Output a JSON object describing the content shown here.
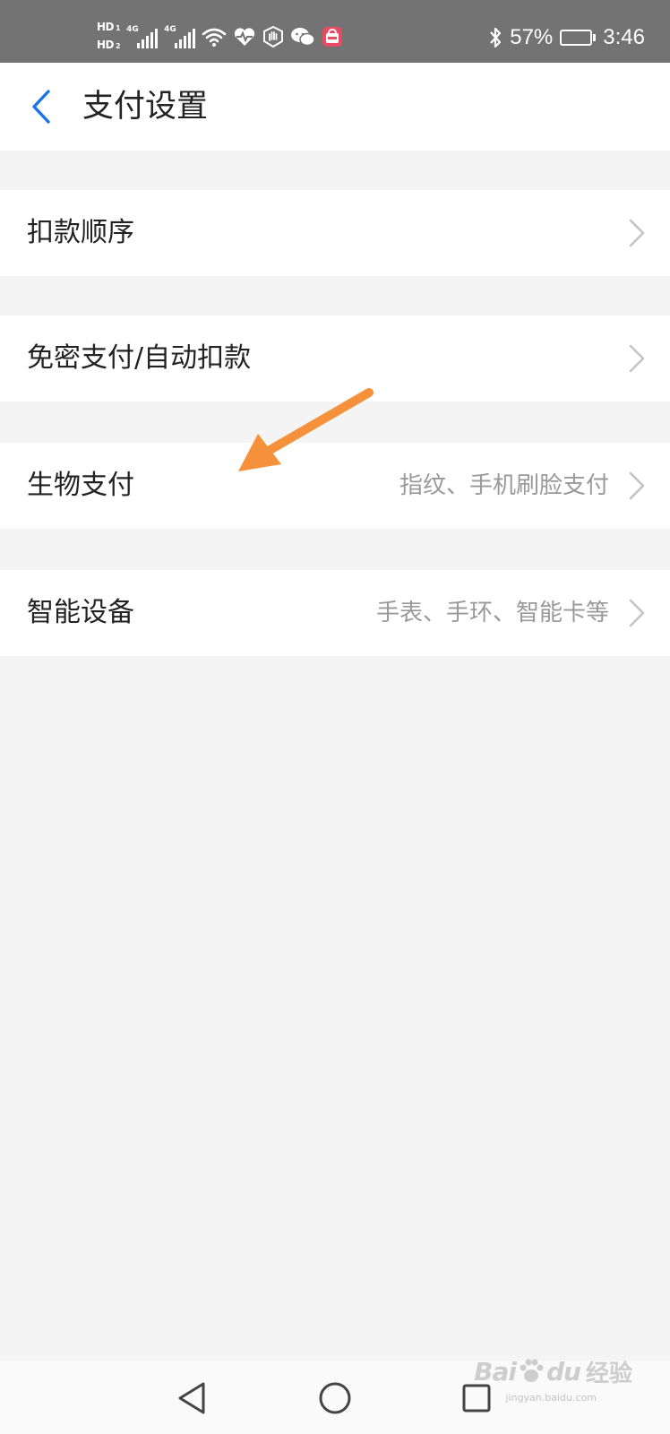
{
  "status_bar": {
    "sim1_label": "HD",
    "sim1_index": "1",
    "sim2_label": "HD",
    "sim2_index": "2",
    "net1": "4G",
    "net2": "4G",
    "battery_text": "57%",
    "battery_level": 0.57,
    "time": "3:46"
  },
  "header": {
    "title": "支付设置"
  },
  "settings": [
    {
      "label": "扣款顺序",
      "value": ""
    },
    {
      "label": "免密支付/自动扣款",
      "value": ""
    },
    {
      "label": "生物支付",
      "value": "指纹、手机刷脸支付"
    },
    {
      "label": "智能设备",
      "value": "手表、手环、智能卡等"
    }
  ],
  "annotation": {
    "color": "#f5913b"
  },
  "watermark": {
    "brand_latin": "Bai",
    "brand_latin_2": "du",
    "brand_cn": "经验",
    "url": "jingyan.baidu.com"
  },
  "colors": {
    "accent": "#1a73e8",
    "status_bar": "#737373",
    "page_bg": "#f4f4f4"
  }
}
